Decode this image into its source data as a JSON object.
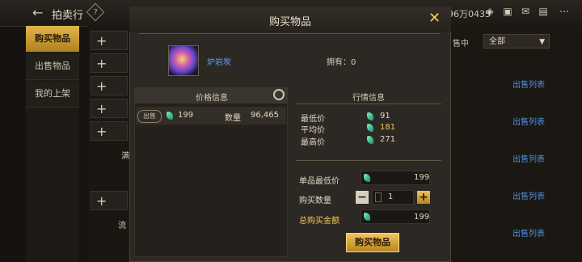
{
  "topbar": {
    "back_icon": "←",
    "title": "拍卖行",
    "currency": "96万0435",
    "question_icon": "?"
  },
  "left_nav": [
    {
      "label": "购买物品",
      "active": true
    },
    {
      "label": "出售物品",
      "active": false
    },
    {
      "label": "我的上架",
      "active": false
    }
  ],
  "list_fragments": {
    "row_text_1": "满",
    "row_text_2": "流"
  },
  "right_panel": {
    "status_fragment": "售中",
    "filter_value": "全部",
    "sell_list_label": "出售列表"
  },
  "modal": {
    "title": "购买物品",
    "item": {
      "name": "炉岩炭",
      "owned_label": "拥有：0"
    },
    "price_panel": {
      "title": "价格信息",
      "badge": "出售",
      "price": "199",
      "qty_label": "数量",
      "qty_value": "96,465"
    },
    "market": {
      "title": "行情信息",
      "rows": [
        {
          "label": "最低价",
          "value": "91"
        },
        {
          "label": "平均价",
          "value": "181"
        },
        {
          "label": "最高价",
          "value": "271"
        }
      ]
    },
    "purchase": {
      "unit_label": "单品最低价",
      "unit_value": "199",
      "qty_label": "购买数量",
      "qty_value": "1",
      "total_label": "总购买金额",
      "total_value": "199",
      "minus": "−",
      "plus": "+"
    },
    "buy_button": "购买物品"
  },
  "colors": {
    "accent_gold": "#e3b54c",
    "link_blue": "#4f8fe0",
    "avg_price": "#f2c85a"
  }
}
